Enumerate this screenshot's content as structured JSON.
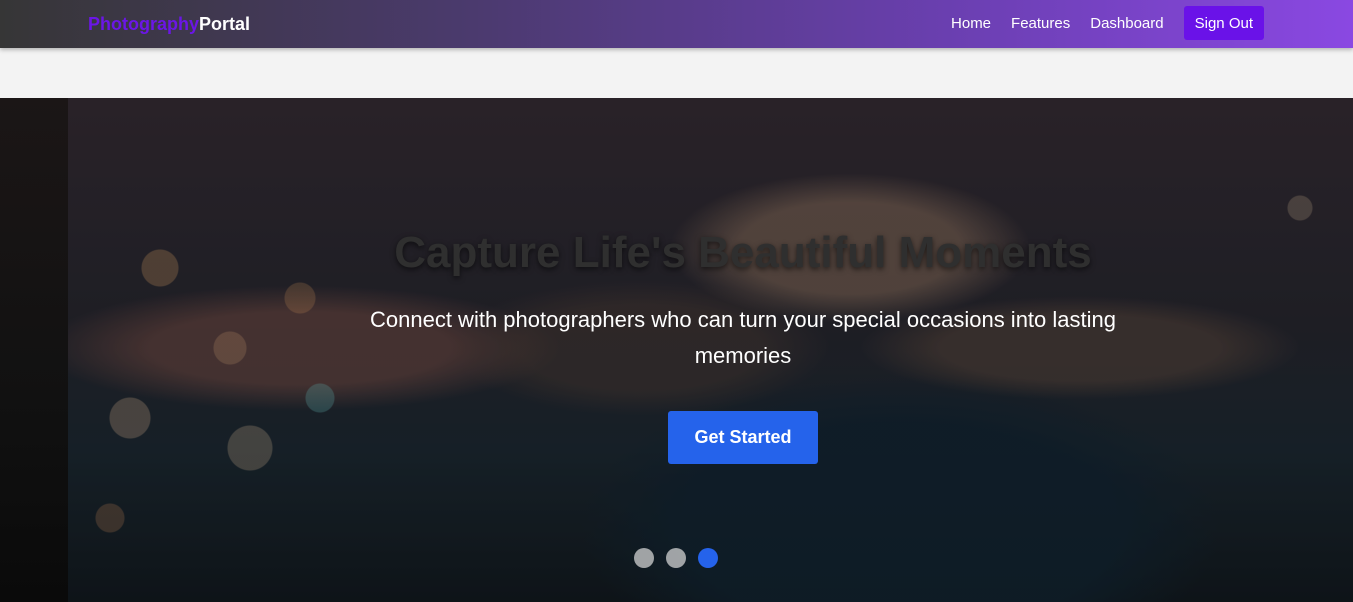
{
  "navbar": {
    "brand_part1": "Photography",
    "brand_part2": "Portal",
    "links": [
      "Home",
      "Features",
      "Dashboard"
    ],
    "signout_label": "Sign Out"
  },
  "hero": {
    "title": "Capture Life's Beautiful Moments",
    "subtitle": "Connect with photographers who can turn your special occasions into lasting memories",
    "cta_label": "Get Started"
  },
  "carousel": {
    "slide_count": 3,
    "active_index": 2
  },
  "colors": {
    "brand_accent": "#6b16e6",
    "signout_bg": "#6a12e8",
    "cta_bg": "#2563eb",
    "active_dot": "#2563eb"
  }
}
